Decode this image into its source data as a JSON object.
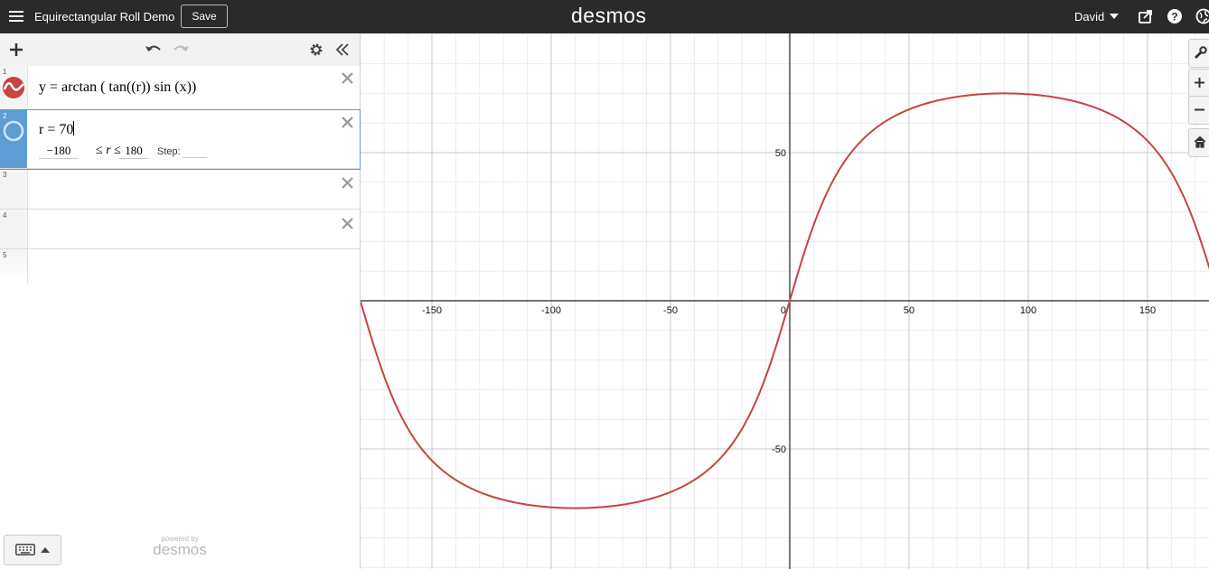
{
  "topbar": {
    "title": "Equirectangular Roll Demo",
    "save_label": "Save",
    "logo": "desmos",
    "user": "David"
  },
  "expressions": [
    {
      "index": "1",
      "latex": "y = arctan ( tan((r)) sin (x))"
    },
    {
      "index": "2",
      "variable": "r",
      "value": "70",
      "slider": {
        "min": "−180",
        "max": "180",
        "step_label": "Step:",
        "step_value": ""
      }
    },
    {
      "index": "3"
    },
    {
      "index": "4"
    },
    {
      "index": "5"
    }
  ],
  "footer": {
    "powered_by": "powered by",
    "brand": "desmos"
  },
  "chart_data": {
    "type": "line",
    "xlim": [
      -180,
      180
    ],
    "ylim": [
      -90,
      90
    ],
    "x_ticks": [
      -150,
      -100,
      -50,
      0,
      50,
      100,
      150
    ],
    "y_ticks": [
      50,
      -50
    ],
    "grid": true,
    "series": [
      {
        "expression": "y = arctan(tan(r) sin(x))",
        "color": "#c74440",
        "r": 70,
        "x_samples": [
          -180,
          -150,
          -120,
          -90,
          -60,
          -30,
          0,
          30,
          60,
          90,
          120,
          150,
          180
        ],
        "y_samples": [
          0,
          -53.9,
          -67.2,
          -70,
          -67.2,
          -53.9,
          0,
          53.9,
          67.2,
          70,
          67.2,
          53.9,
          0
        ]
      }
    ]
  },
  "colors": {
    "accent": "#5d9cd5",
    "curve": "#c74440",
    "topbar": "#2a2a2a"
  }
}
